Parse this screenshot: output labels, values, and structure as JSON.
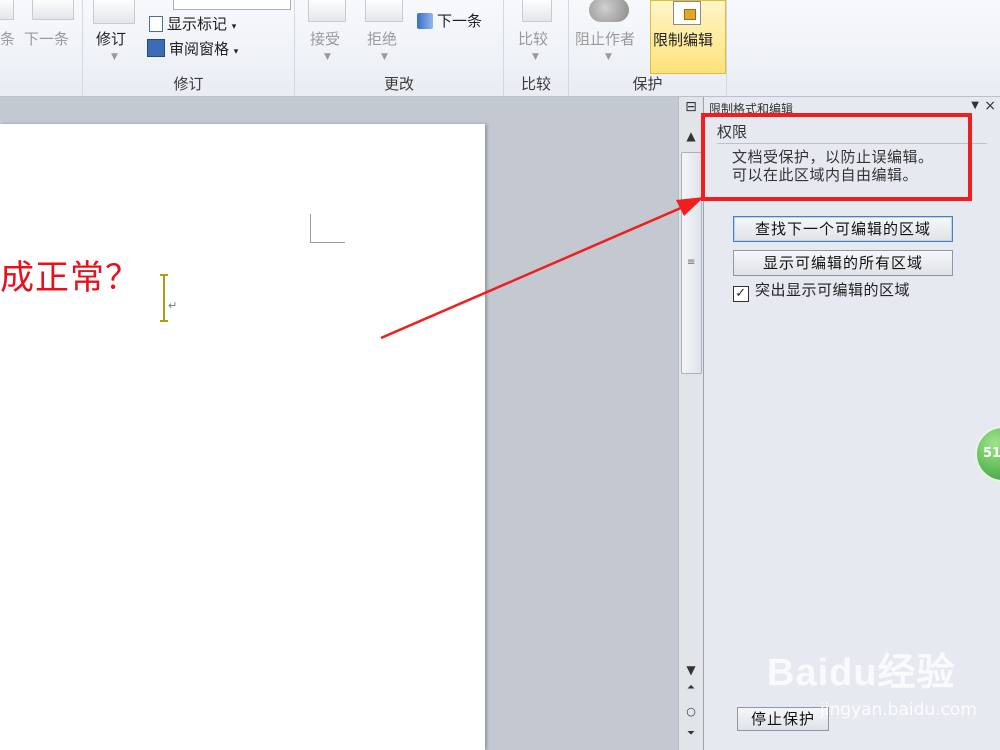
{
  "ribbon": {
    "groups": {
      "revision": {
        "label": "修订",
        "track_changes": "修订",
        "show_markup": "显示标记",
        "review_pane": "审阅窗格"
      },
      "changes": {
        "label": "更改",
        "accept": "接受",
        "reject": "拒绝",
        "next": "下一条"
      },
      "compare": {
        "label": "比较",
        "compare": "比较"
      },
      "protect": {
        "label": "保护",
        "block_authors": "阻止作者",
        "restrict_editing": "限制编辑"
      }
    },
    "comments": {
      "prev": "条",
      "next": "下一条"
    }
  },
  "document": {
    "text": "成正常？",
    "para_mark": "↵"
  },
  "pane": {
    "title": "限制格式和编辑",
    "section": "权限",
    "line1": "文档受保护，以防止误编辑。",
    "line2": "可以在此区域内自由编辑。",
    "find_next": "查找下一个可编辑的区域",
    "show_all": "显示可编辑的所有区域",
    "highlight": "突出显示可编辑的区域",
    "highlight_checked": true,
    "stop": "停止保护"
  },
  "overlay": {
    "badge": "51",
    "watermark": "Baidu经验",
    "watermark_sub": "jingyan.baidu.com"
  },
  "colors": {
    "annotation": "#f21d1d",
    "doc_text": "#e8101c",
    "active_button": "#fde27a"
  }
}
